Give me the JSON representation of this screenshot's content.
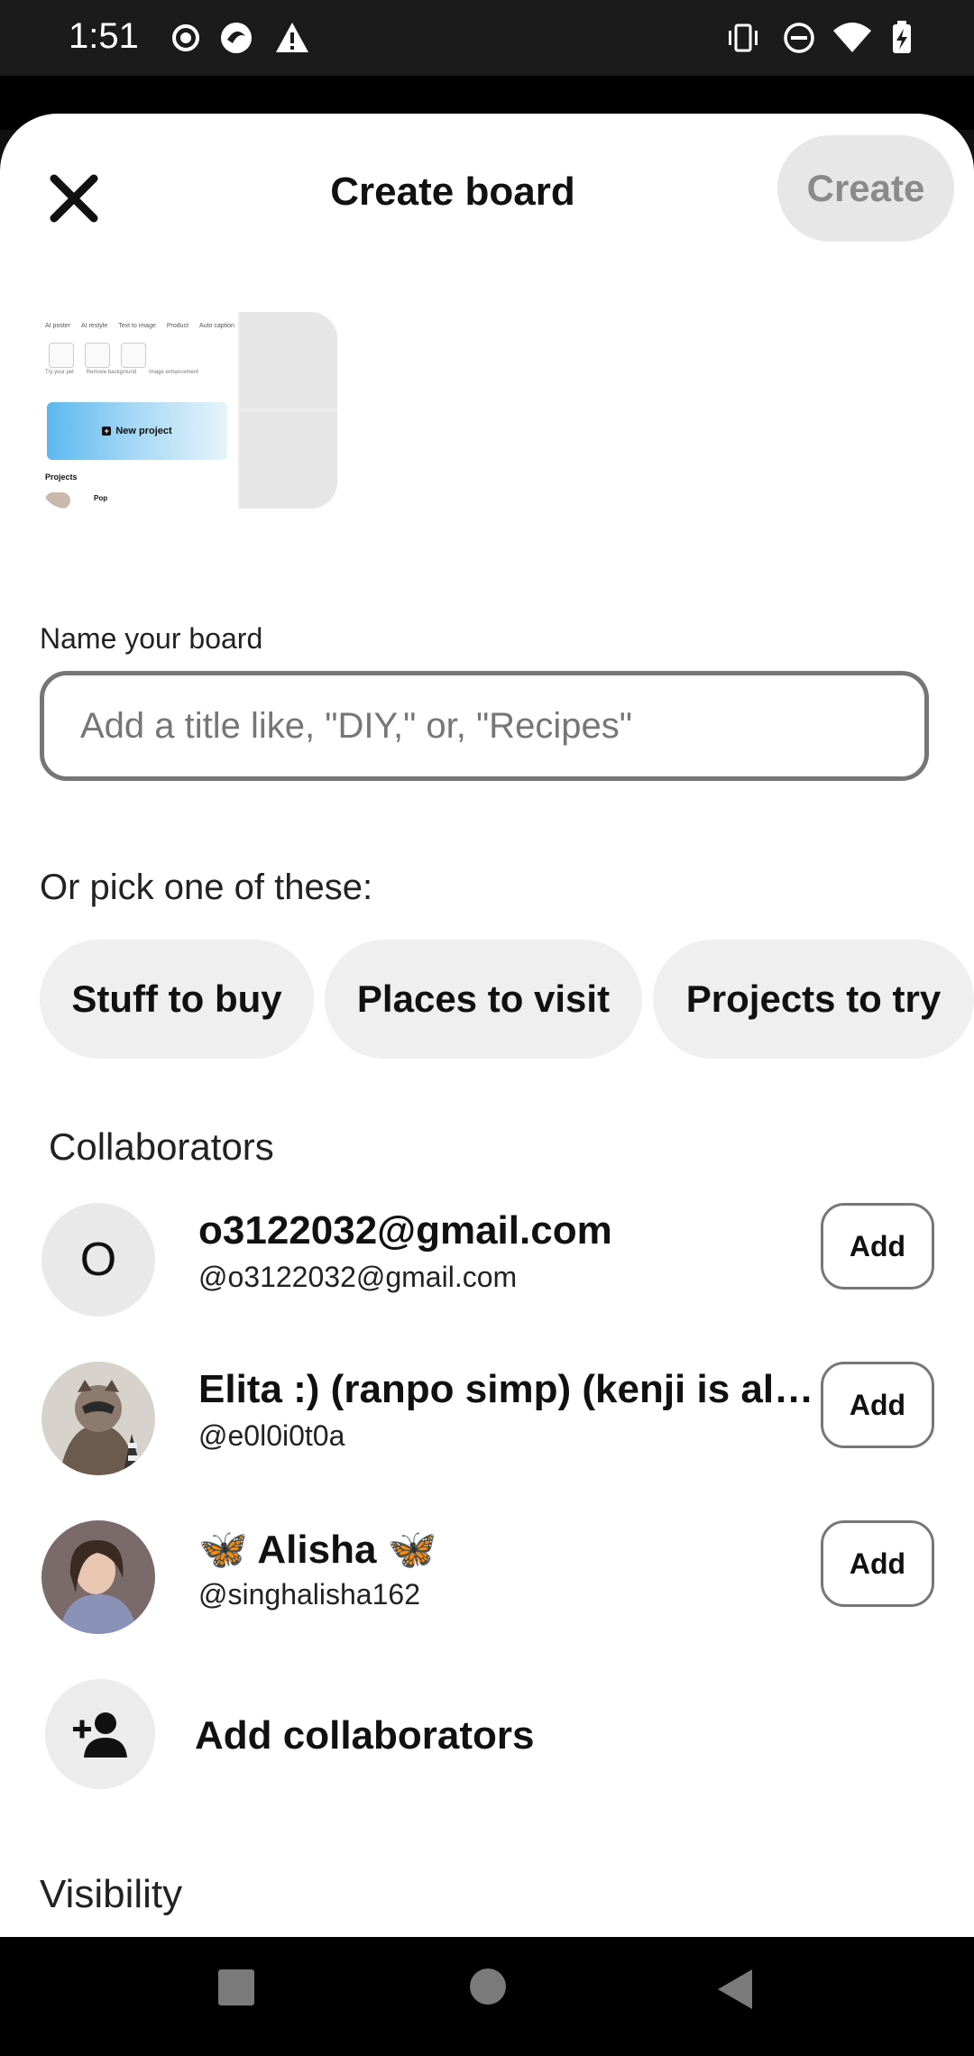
{
  "status_bar": {
    "time": "1:51",
    "left_icons": [
      "record-icon",
      "app-icon",
      "warning-icon"
    ],
    "right_icons": [
      "vibrate-icon",
      "do-not-disturb-icon",
      "wifi-icon",
      "battery-icon"
    ]
  },
  "header": {
    "title": "Create board",
    "create_label": "Create",
    "close_icon": "close-icon"
  },
  "preview": {
    "mini_labels": [
      "AI poster",
      "AI restyle",
      "Text to image",
      "Product",
      "Auto caption"
    ],
    "mini_sub": [
      "Try your pet",
      "Remove background",
      "Image enhancement"
    ],
    "new_project": "New project",
    "projects": "Projects",
    "pop": "Pop"
  },
  "form": {
    "name_label": "Name your board",
    "name_placeholder": "Add a title like, \"DIY,\" or, \"Recipes\"",
    "pick_label": "Or pick one of these:",
    "suggestions": [
      "Stuff to buy",
      "Places to visit",
      "Projects to try"
    ]
  },
  "collaborators": {
    "label": "Collaborators",
    "people": [
      {
        "name": "o3122032@gmail.com",
        "handle": "@o3122032@gmail.com",
        "initial": "O",
        "add_label": "Add"
      },
      {
        "name": "Elita :) (ranpo simp) (kenji is alive...",
        "handle": "@e0l0i0t0a",
        "add_label": "Add"
      },
      {
        "name": "🦋 Alisha 🦋",
        "handle": "@singhalisha162",
        "add_label": "Add"
      }
    ],
    "add_collaborators": "Add collaborators"
  },
  "visibility": {
    "label": "Visibility"
  },
  "nav": {
    "icons": [
      "recents-icon",
      "home-icon",
      "back-icon"
    ]
  },
  "colors": {
    "chip_bg": "#efefef",
    "create_bg": "#e7e7e7",
    "create_text": "#8a8a8a"
  }
}
